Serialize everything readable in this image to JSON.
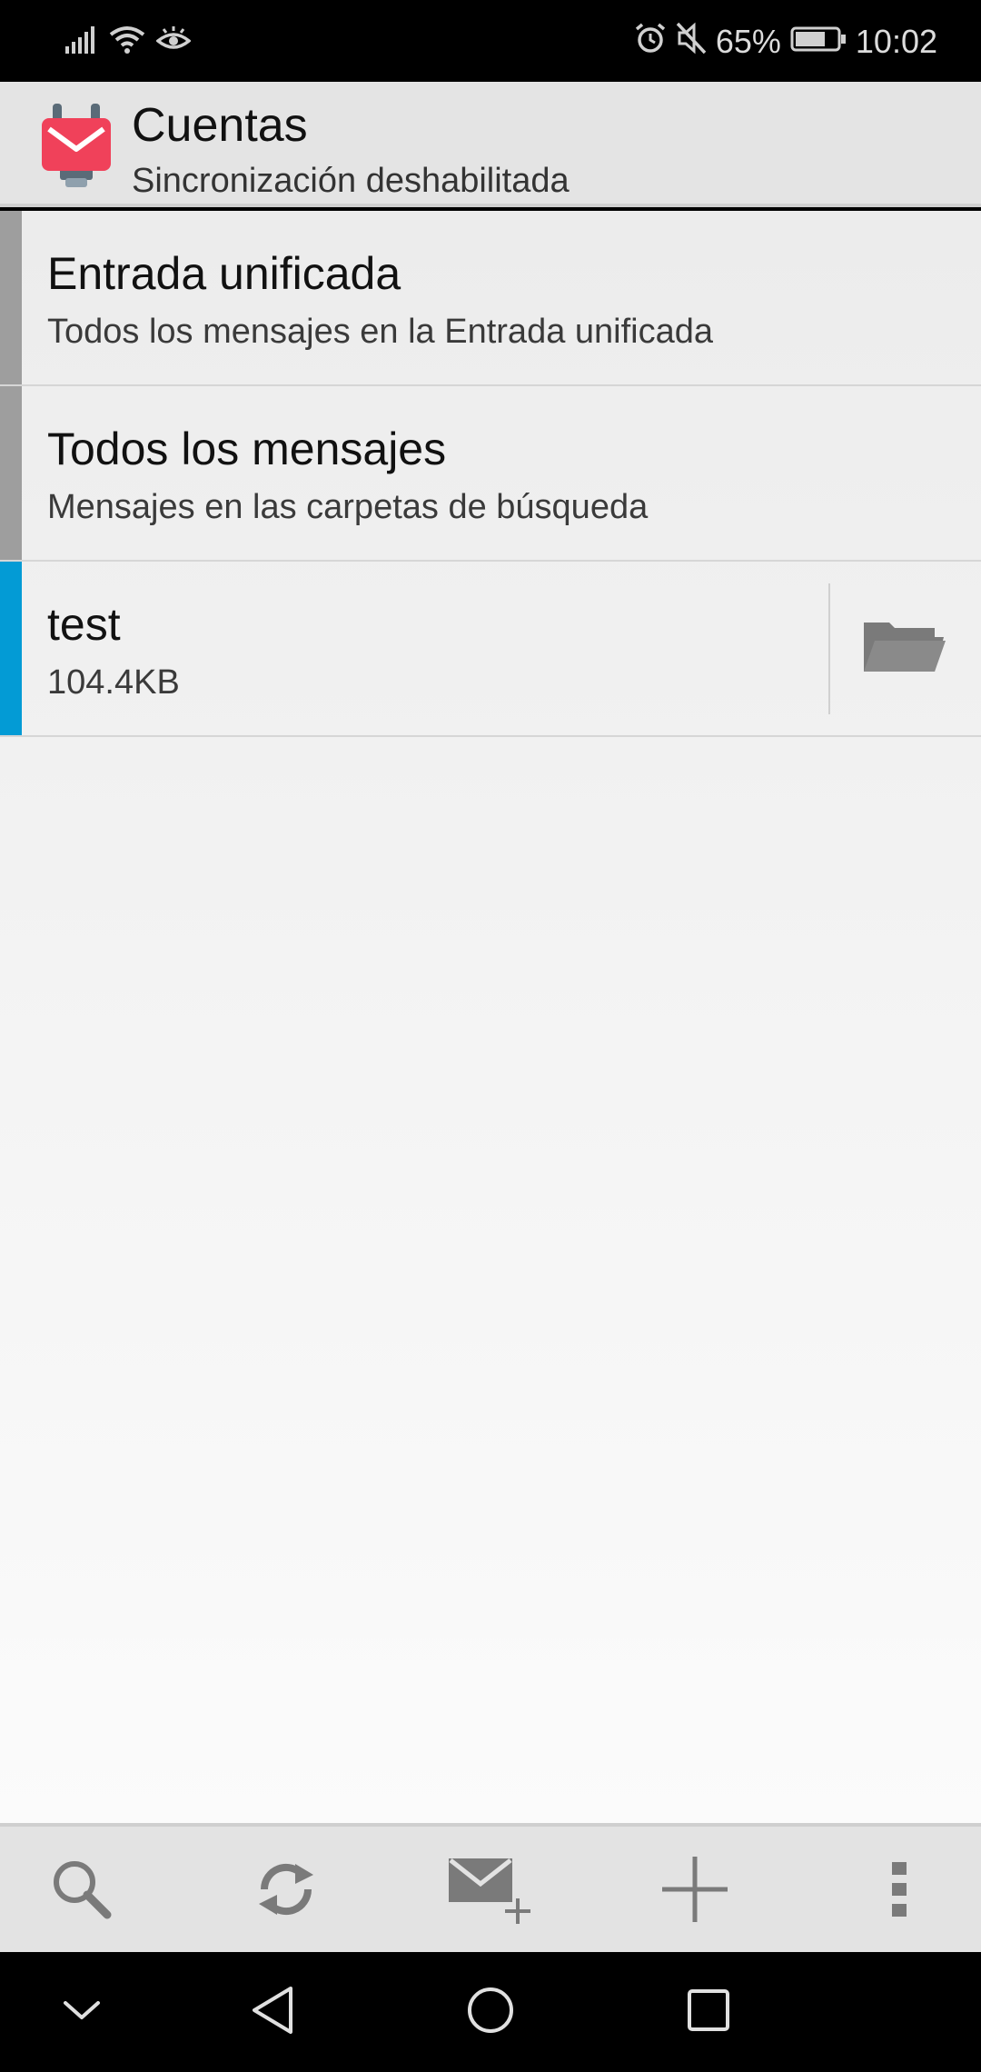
{
  "status_bar": {
    "battery_percent": "65%",
    "time": "10:02",
    "icons": [
      "signal-icon",
      "wifi-icon",
      "eye-comfort-icon",
      "alarm-icon",
      "mute-icon",
      "battery-icon"
    ]
  },
  "app_bar": {
    "title": "Cuentas",
    "subtitle": "Sincronización deshabilitada",
    "logo": "k9-mail-logo"
  },
  "accounts": [
    {
      "title": "Entrada unificada",
      "subtitle": "Todos los mensajes en la Entrada unificada",
      "indicator_color": "#9e9e9e"
    },
    {
      "title": "Todos los mensajes",
      "subtitle": "Mensajes en las carpetas de búsqueda",
      "indicator_color": "#9e9e9e"
    },
    {
      "title": "test",
      "subtitle": "104.4KB",
      "indicator_color": "#039BD5",
      "folder_icon": "folder-open-icon"
    }
  ],
  "toolbar": {
    "icons": [
      "search-icon",
      "refresh-icon",
      "compose-icon",
      "add-icon",
      "more-vert-icon"
    ]
  },
  "nav_bar": {
    "icons": [
      "collapse-icon",
      "back-icon",
      "home-icon",
      "recents-icon"
    ]
  },
  "colors": {
    "accent_blue": "#039BD5",
    "logo_red": "#F0415A",
    "icon_gray": "#7a7a7a"
  }
}
